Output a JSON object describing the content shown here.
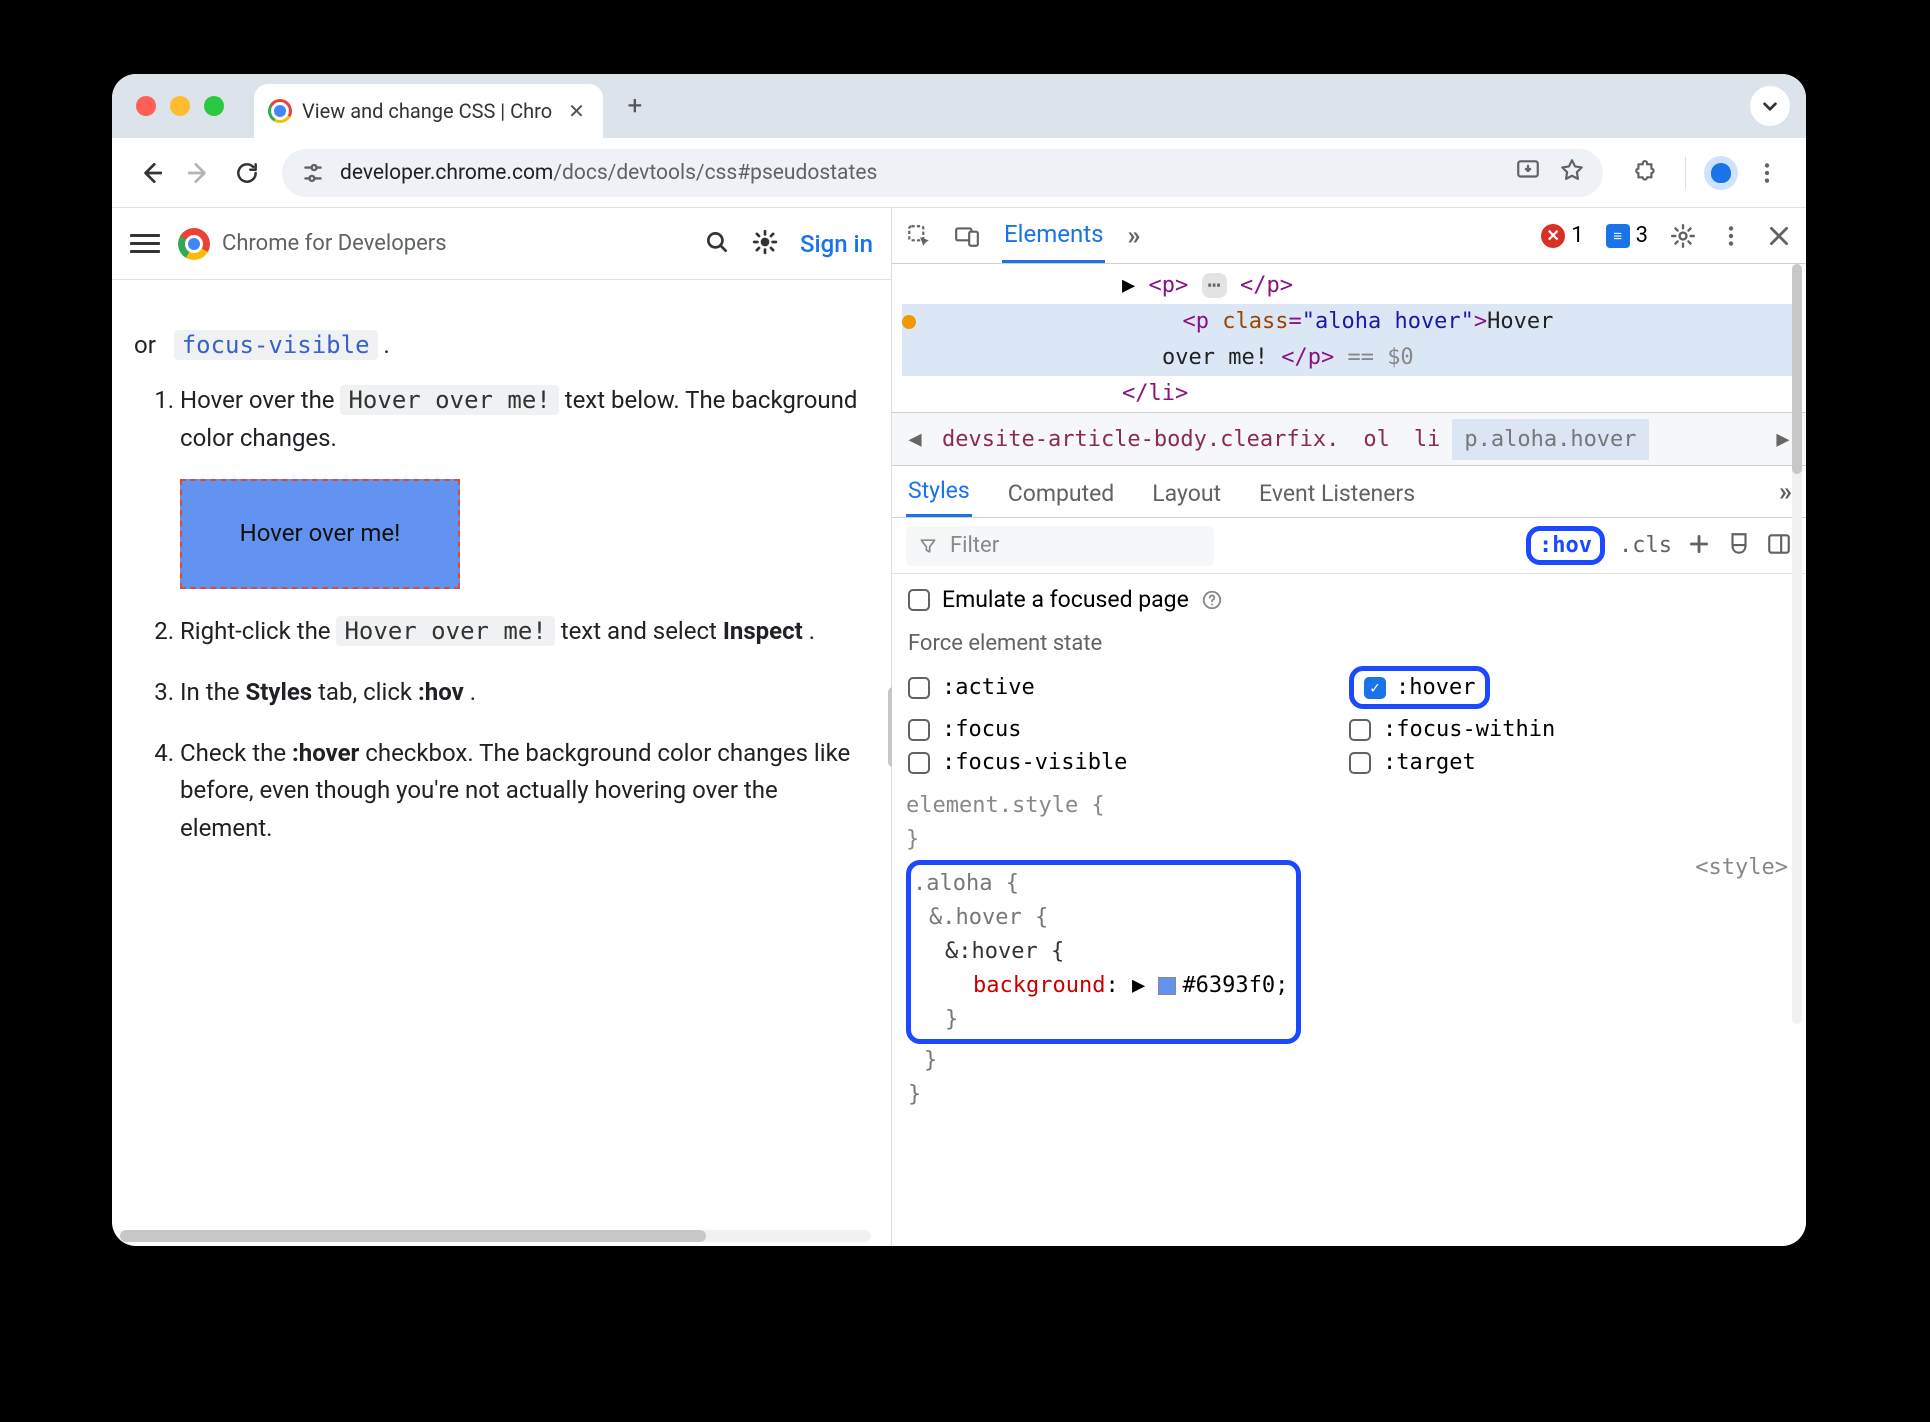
{
  "window": {
    "tab_title": "View and change CSS  |  Chro",
    "url_host": "developer.chrome.com",
    "url_path": "/docs/devtools/css#pseudostates"
  },
  "page": {
    "brand": "Chrome for Developers",
    "signin": "Sign in",
    "cut_line_or": "or",
    "focus_visible": "focus-visible",
    "period": ".",
    "steps": {
      "s1a": "Hover over the ",
      "hover_code": "Hover over me!",
      "s1b": " text below. The background color changes.",
      "hover_demo": "Hover over me!",
      "s2a": "Right-click the ",
      "s2b": " text and select ",
      "inspect": "Inspect",
      "s2c": ".",
      "s3a": "In the ",
      "styles": "Styles",
      "s3b": " tab, click ",
      "hov": ":hov",
      "s3c": ".",
      "s4a": "Check the ",
      "hover_b": ":hover",
      "s4b": " checkbox. The background color changes like before, even though you're not actually hovering over the element."
    }
  },
  "devtools": {
    "toolbar": {
      "elements": "Elements",
      "err_count": "1",
      "msg_count": "3"
    },
    "dom": {
      "l1_open": "<p>",
      "l1_ell": "⋯",
      "l1_close": "</p>",
      "l2": "<p class=\"aloha hover\">Hover",
      "l3a": "over me!",
      "l3b": "</p>",
      "l3c": " == $0",
      "l4": "</li>"
    },
    "breadcrumb": {
      "b1": "devsite-article-body.clearfix.",
      "b2": "ol",
      "b3": "li",
      "b4": "p.aloha.hover"
    },
    "tabs": {
      "styles": "Styles",
      "computed": "Computed",
      "layout": "Layout",
      "events": "Event Listeners"
    },
    "filter": {
      "placeholder": "Filter",
      "hov": ":hov",
      "cls": ".cls"
    },
    "emulate": {
      "label": "Emulate a focused page"
    },
    "force": {
      "title": "Force element state",
      "active": ":active",
      "hover": ":hover",
      "focus": ":focus",
      "focus_within": ":focus-within",
      "focus_visible": ":focus-visible",
      "target": ":target"
    },
    "rules": {
      "element_style": "element.style {",
      "close": "}",
      "aloha_open": ".aloha {",
      "hover_open": "&.hover {",
      "pseudo_open": "&:hover {",
      "bg_prop": "background",
      "bg_val": "#6393f0",
      "source": "<style>"
    }
  }
}
